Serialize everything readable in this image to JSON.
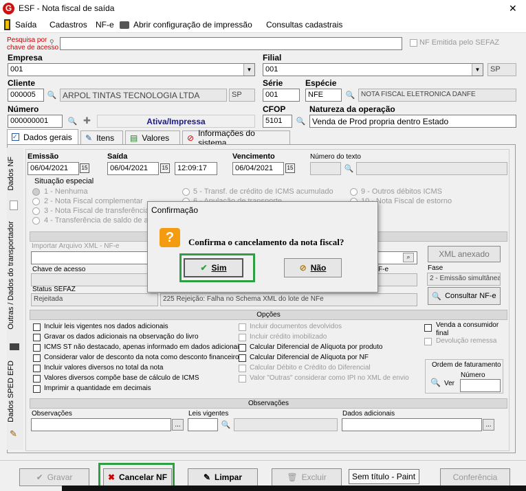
{
  "window": {
    "title": "ESF - Nota fiscal de saída",
    "close": "✕"
  },
  "menu": {
    "saida": "Saída",
    "cadastros": "Cadastros",
    "nfe": "NF-e",
    "config": "Abrir configuração de impressão",
    "consultas": "Consultas cadastrais"
  },
  "search": {
    "label_line1": "Pesquisa por",
    "label_line2": "chave de acesso",
    "nf_emitida": "NF Emitida pelo SEFAZ"
  },
  "header": {
    "empresa_label": "Empresa",
    "empresa_value": "001",
    "filial_label": "Filial",
    "filial_value": "001",
    "filial_uf": "SP",
    "cliente_label": "Cliente",
    "cliente_code": "000005",
    "cliente_name": "ARPOL TINTAS TECNOLOGIA LTDA",
    "cliente_uf": "SP",
    "serie_label": "Série",
    "serie_value": "001",
    "especie_label": "Espécie",
    "especie_value": "NFE",
    "especie_desc": "NOTA FISCAL ELETRONICA DANFE",
    "numero_label": "Número",
    "numero_value": "000000001",
    "numero_status": "Ativa/Impressa",
    "cfop_label": "CFOP",
    "cfop_value": "5101",
    "natureza_label": "Natureza da operação",
    "natureza_value": "Venda de Prod propria dentro Estado"
  },
  "tabs": {
    "dados_gerais": "Dados gerais",
    "itens": "Itens",
    "valores": "Valores",
    "info_sistema": "Informações do sistema"
  },
  "vtabs": {
    "dados_nf": "Dados NF",
    "outras": "Outras / Dados do transportador",
    "sped": "Dados SPED EFD"
  },
  "dates": {
    "emissao_label": "Emissão",
    "emissao_value": "06/04/2021",
    "saida_label": "Saída",
    "saida_value": "06/04/2021",
    "saida_time": "12:09:17",
    "venc_label": "Vencimento",
    "venc_value": "06/04/2021",
    "numero_texto_label": "Número do texto"
  },
  "situacao": {
    "title": "Situação especial",
    "options": [
      "1 - Nenhuma",
      "2 - Nota Fiscal complementar",
      "3 - Nota Fiscal de transferência",
      "4 - Transferência de saldo de ap",
      "5 - Transf. de crédito de ICMS acumulado",
      "6 - Anulação de transporte",
      "9 - Outros débitos ICMS",
      "10 - Nota Fiscal de estorno"
    ]
  },
  "nfe_section": {
    "importar_label": "Importar Arquivo XML - NF-e",
    "xml_anexado": "XML anexado",
    "chave_label": "Chave de acesso",
    "nfe_suffix": "F-e",
    "fase_label": "Fase",
    "fase_value": "2 - Emissão simultânea",
    "status_label": "Status SEFAZ",
    "status_value": "Rejeitada",
    "rejeicao_value": "225 Rejeição: Falha no Schema XML do lote de NFe",
    "consultar": "Consultar NF-e"
  },
  "opcoes": {
    "title": "Opções",
    "col1": [
      "Incluir leis vigentes nos dados adicionais",
      "Gravar os dados adicionais na observação do livro",
      "ICMS ST não destacado, apenas informado em dados adicionais",
      "Considerar valor de desconto da nota como desconto financeiro",
      "Incluir valores diversos no total da nota",
      "Valores diversos compõe base de cálculo de ICMS",
      "Imprimir a quantidade em decimais"
    ],
    "col2": [
      "Incluir documentos devolvidos",
      "Incluir crédito imobilizado",
      "Calcular Diferencial de Alíquota por produto",
      "Calcular Diferencial de Alíquota por NF",
      "Calcular Débito e Crédito do Diferencial",
      "Valor \"Outras\" considerar como IPI no XML de envio"
    ],
    "venda_consumidor_1": "Venda a consumidor",
    "venda_consumidor_2": "final",
    "devolucao": "Devolução remessa",
    "ordem_title": "Ordem de faturamento",
    "ordem_numero": "Número",
    "ordem_ver": "Ver"
  },
  "observacoes": {
    "title": "Observações",
    "obs_label": "Observações",
    "leis_label": "Leis vigentes",
    "dados_label": "Dados adicionais",
    "ellipsis": "..."
  },
  "footer": {
    "gravar": "Gravar",
    "cancelar": "Cancelar NF",
    "limpar": "Limpar",
    "excluir": "Excluir",
    "conferencia": "Conferência",
    "tooltip": "Sem título - Paint"
  },
  "dialog": {
    "title": "Confirmação",
    "message": "Confirma o cancelamento da nota fiscal?",
    "sim": "Sim",
    "nao": "Não"
  },
  "colors": {
    "highlight": "#2ea043",
    "title_red": "#cc0000"
  }
}
